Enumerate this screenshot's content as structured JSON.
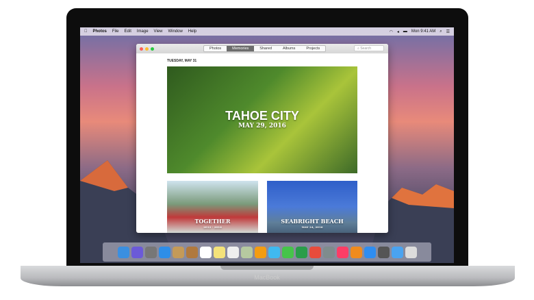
{
  "device": {
    "label": "MacBook"
  },
  "menubar": {
    "app": "Photos",
    "items": [
      "File",
      "Edit",
      "Image",
      "View",
      "Window",
      "Help"
    ],
    "clock": "Mon 9:41 AM"
  },
  "toolbar": {
    "tabs": [
      "Photos",
      "Memories",
      "Shared",
      "Albums",
      "Projects"
    ],
    "active": "Memories",
    "search_placeholder": "Search"
  },
  "content": {
    "date": "TUESDAY, MAY 31",
    "memories": [
      {
        "title": "TAHOE CITY",
        "subtitle": "MAY 29, 2016"
      },
      {
        "title": "TOGETHER",
        "subtitle": "2012 - 2016"
      },
      {
        "title": "SEABRIGHT BEACH",
        "subtitle": "MAY 24, 2016"
      }
    ]
  },
  "dock": {
    "colors": [
      "#3b8fe0",
      "#6b5ad8",
      "#777",
      "#2e8ee8",
      "#c49a58",
      "#b0793e",
      "#ffffff",
      "#f4e27a",
      "#eeeeee",
      "#b6c9a0",
      "#f39c12",
      "#3fb9f0",
      "#46c44a",
      "#2a9d4a",
      "#e74c3c",
      "#7f8c8d",
      "#fc3d66",
      "#f08b1d",
      "#2f8df0",
      "#555",
      "#4aa3f0",
      "#dcdcdc"
    ]
  }
}
